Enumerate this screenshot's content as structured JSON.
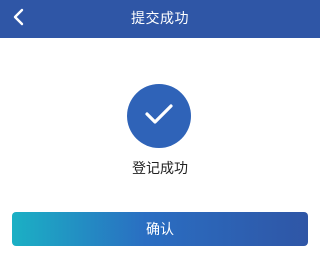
{
  "header": {
    "title": "提交成功",
    "back_icon": "chevron-left-icon"
  },
  "result": {
    "icon": "checkmark-icon",
    "message": "登记成功"
  },
  "actions": {
    "confirm_label": "确认"
  },
  "colors": {
    "header_bg": "#2f56a6",
    "circle_bg": "#2f63b8",
    "button_gradient_start": "#1bb0c4",
    "button_gradient_end": "#2f56a6"
  }
}
